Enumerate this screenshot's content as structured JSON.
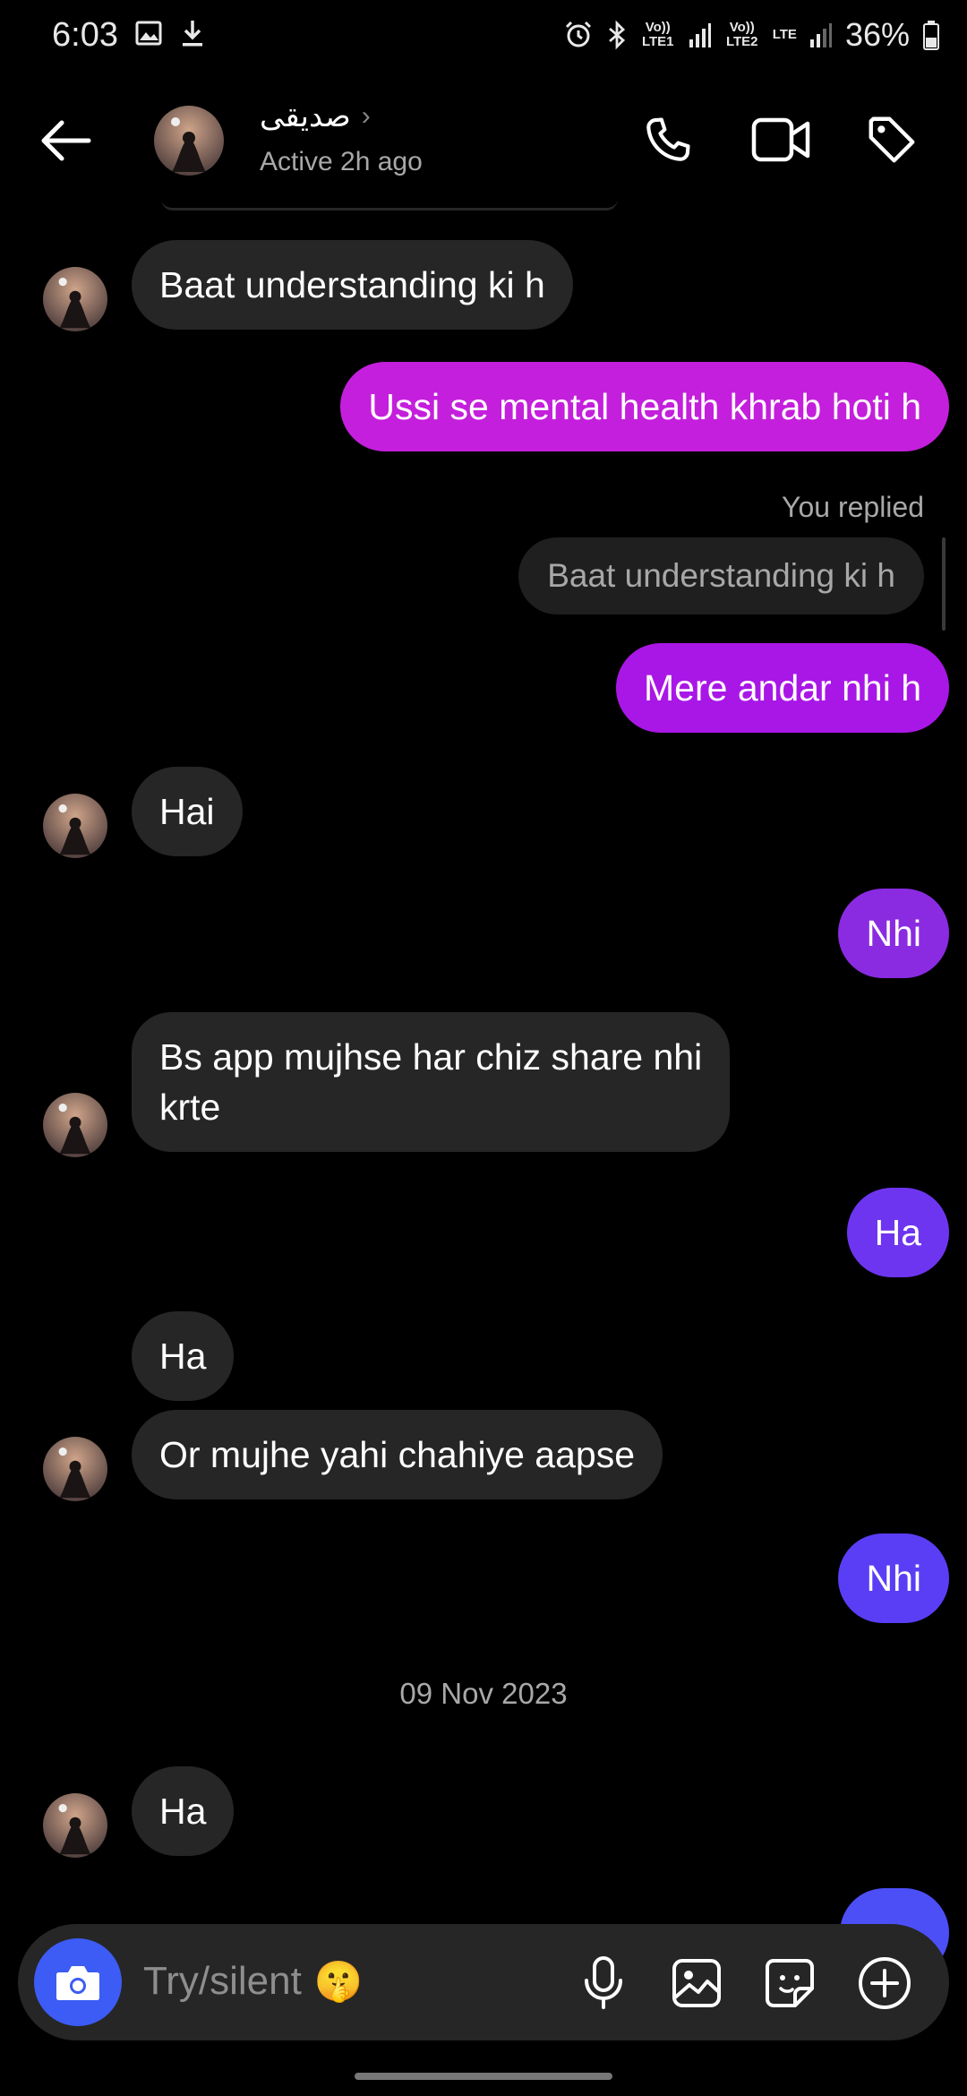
{
  "status_bar": {
    "time": "6:03",
    "sim1_label": "Vo)) LTE1",
    "sim2_label": "Vo)) LTE2",
    "lte_label": "LTE",
    "battery": "36%"
  },
  "header": {
    "contact_name": "صدیقی",
    "active_status": "Active 2h ago",
    "icons": [
      "back-arrow-icon",
      "phone-icon",
      "video-icon",
      "tag-icon"
    ]
  },
  "messages": [
    {
      "side": "received",
      "text": "Baat understanding ki h"
    },
    {
      "side": "sent",
      "text": "Ussi se mental health khrab hoti h",
      "color": "#c41fdc"
    },
    {
      "reply_label": "You replied",
      "reply_quote": "Baat understanding ki h"
    },
    {
      "side": "sent",
      "text": "Mere andar nhi h",
      "color": "#a917e6"
    },
    {
      "side": "received",
      "text": "Hai"
    },
    {
      "side": "sent",
      "text": "Nhi",
      "color": "#8a2be2"
    },
    {
      "side": "received",
      "line1": "Bs app mujhse har chiz share nhi",
      "line2": "krte"
    },
    {
      "side": "sent",
      "text": "Ha",
      "color": "#6e35f0"
    },
    {
      "side": "received",
      "text": "Ha"
    },
    {
      "side": "received",
      "text": "Or mujhe yahi chahiye aapse"
    },
    {
      "side": "sent",
      "text": "Nhi",
      "color": "#5a3ef5"
    },
    {
      "side": "received",
      "text": "Ha"
    }
  ],
  "date_separator": "09 Nov 2023",
  "composer": {
    "placeholder": "Try/silent",
    "emoji": "🤫",
    "icons": [
      "camera-icon",
      "microphone-icon",
      "gallery-icon",
      "sticker-icon",
      "add-icon"
    ]
  },
  "colors": {
    "received_bubble": "#262626",
    "camera_button": "#3c5cf5"
  }
}
